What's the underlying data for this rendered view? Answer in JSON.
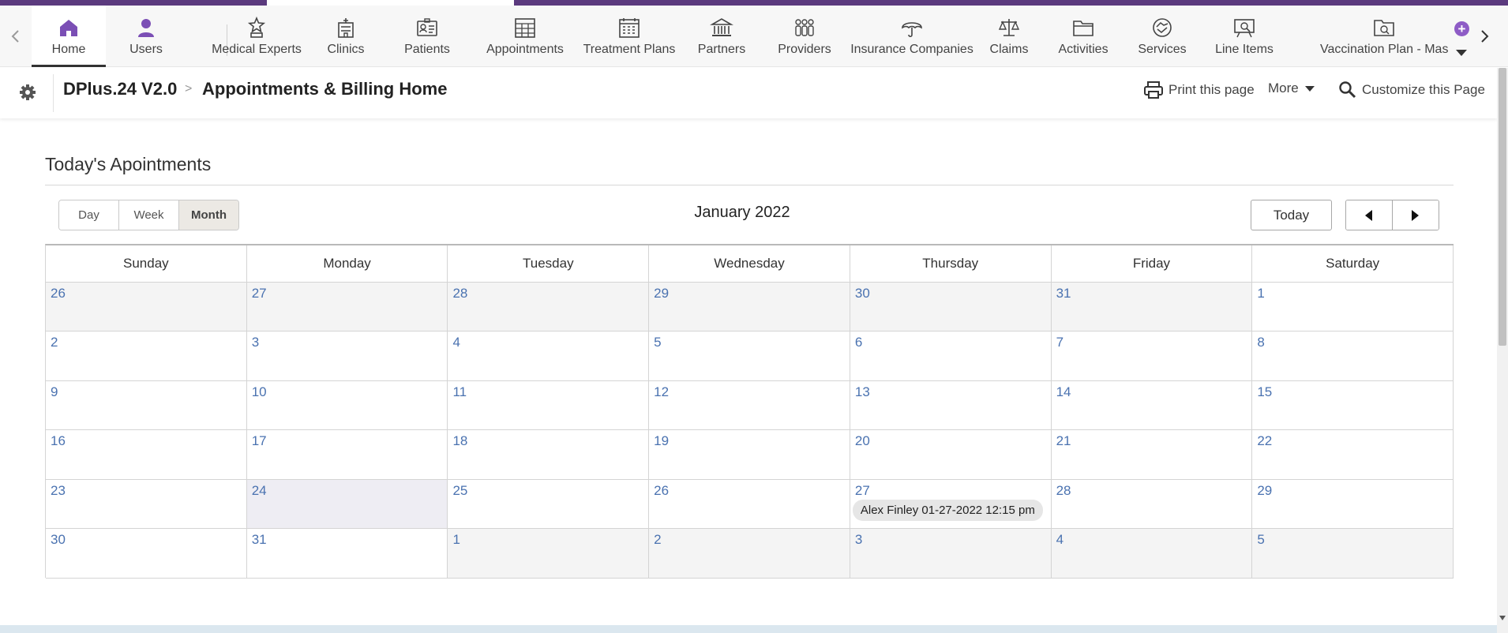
{
  "nav": {
    "items": [
      {
        "label": "Home",
        "icon": "home-icon",
        "active": true
      },
      {
        "label": "Users",
        "icon": "user-icon"
      },
      {
        "label": "Medical Experts",
        "icon": "medal-icon"
      },
      {
        "label": "Clinics",
        "icon": "hospital-icon"
      },
      {
        "label": "Patients",
        "icon": "id-card-icon"
      },
      {
        "label": "Appointments",
        "icon": "grid-calendar-icon"
      },
      {
        "label": "Treatment Plans",
        "icon": "calendar-icon"
      },
      {
        "label": "Partners",
        "icon": "bank-icon"
      },
      {
        "label": "Providers",
        "icon": "group-icon"
      },
      {
        "label": "Insurance Companies",
        "icon": "umbrella-icon"
      },
      {
        "label": "Claims",
        "icon": "scales-icon"
      },
      {
        "label": "Activities",
        "icon": "folder-icon"
      },
      {
        "label": "Services",
        "icon": "handshake-icon"
      },
      {
        "label": "Line Items",
        "icon": "search-board-icon"
      },
      {
        "label": "Vaccination Plan - Mast",
        "icon": "folder-search-icon"
      }
    ]
  },
  "breadcrumb": {
    "app": "DPlus.24 V2.0",
    "separator": ">",
    "page": "Appointments & Billing Home"
  },
  "actions": {
    "print": "Print this page",
    "more": "More",
    "customize": "Customize this Page"
  },
  "section": {
    "title": "Today's Apointments"
  },
  "calendar": {
    "views": [
      "Day",
      "Week",
      "Month"
    ],
    "active_view": "Month",
    "title": "January 2022",
    "today_label": "Today",
    "weekdays": [
      "Sunday",
      "Monday",
      "Tuesday",
      "Wednesday",
      "Thursday",
      "Friday",
      "Saturday"
    ],
    "weeks": [
      [
        "26",
        "27",
        "28",
        "29",
        "30",
        "31",
        "1"
      ],
      [
        "2",
        "3",
        "4",
        "5",
        "6",
        "7",
        "8"
      ],
      [
        "9",
        "10",
        "11",
        "12",
        "13",
        "14",
        "15"
      ],
      [
        "16",
        "17",
        "18",
        "19",
        "20",
        "21",
        "22"
      ],
      [
        "23",
        "24",
        "25",
        "26",
        "27",
        "28",
        "29"
      ],
      [
        "30",
        "31",
        "1",
        "2",
        "3",
        "4",
        "5"
      ]
    ],
    "event": {
      "label": "Alex Finley 01-27-2022 12:15 pm"
    }
  },
  "colors": {
    "brand_purple": "#5b3a7e",
    "accent_purple": "#8e5cc6",
    "day_link": "#4a72b0"
  }
}
